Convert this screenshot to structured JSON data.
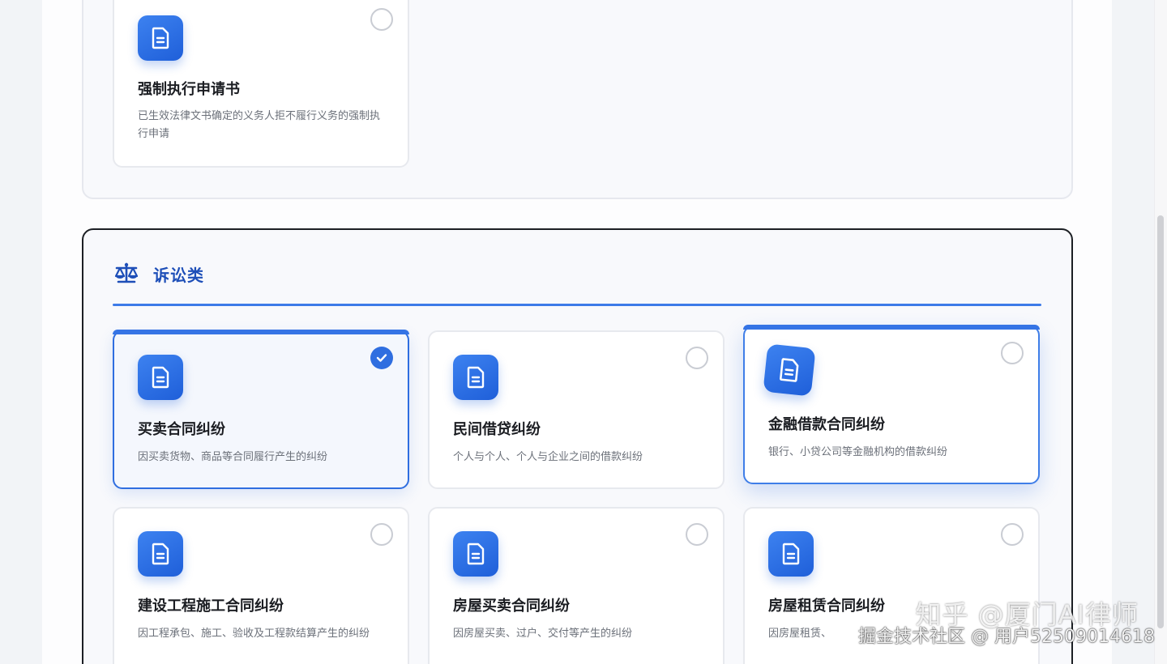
{
  "top_section": {
    "cards": [
      {
        "title": "强制执行申请书",
        "desc": "已生效法律文书确定的义务人拒不履行义务的强制执行申请",
        "icon": "document-icon",
        "selected": false
      }
    ]
  },
  "litigation_section": {
    "title": "诉讼类",
    "icon": "scale-icon",
    "accent_color": "#2f6ee0",
    "cards": [
      {
        "title": "买卖合同纠纷",
        "desc": "因买卖货物、商品等合同履行产生的纠纷",
        "icon": "document-icon",
        "selected": true
      },
      {
        "title": "民间借贷纠纷",
        "desc": "个人与个人、个人与企业之间的借款纠纷",
        "icon": "document-icon",
        "selected": false
      },
      {
        "title": "金融借款合同纠纷",
        "desc": "银行、小贷公司等金融机构的借款纠纷",
        "icon": "document-icon",
        "selected": false
      },
      {
        "title": "建设工程施工合同纠纷",
        "desc": "因工程承包、施工、验收及工程款结算产生的纠纷",
        "icon": "document-icon",
        "selected": false
      },
      {
        "title": "房屋买卖合同纠纷",
        "desc": "因房屋买卖、过户、交付等产生的纠纷",
        "icon": "document-icon",
        "selected": false
      },
      {
        "title": "房屋租赁合同纠纷",
        "desc": "因房屋租赁、",
        "icon": "document-icon",
        "selected": false
      }
    ]
  },
  "watermark": {
    "line1": "知乎 @厦门AI律师",
    "line2": "掘金技术社区 @ 用户52509014618"
  }
}
